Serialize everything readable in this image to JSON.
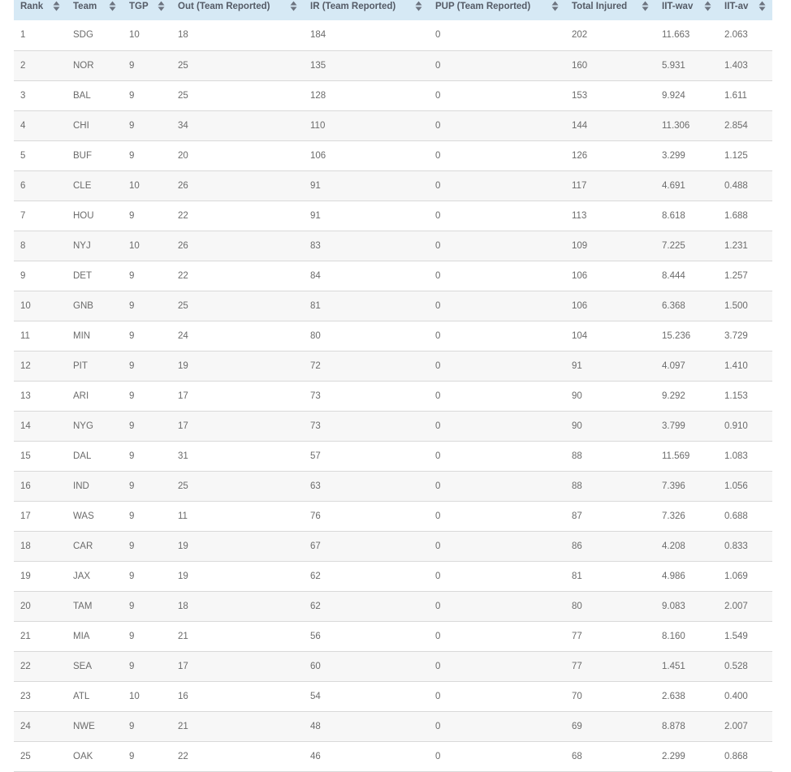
{
  "table": {
    "columns": [
      "Rank",
      "Team",
      "TGP",
      "Out (Team Reported)",
      "IR (Team Reported)",
      "PUP (Team Reported)",
      "Total Injured",
      "IIT-wav",
      "IIT-av"
    ],
    "rows": [
      [
        "1",
        "SDG",
        "10",
        "18",
        "184",
        "0",
        "202",
        "11.663",
        "2.063"
      ],
      [
        "2",
        "NOR",
        "9",
        "25",
        "135",
        "0",
        "160",
        "5.931",
        "1.403"
      ],
      [
        "3",
        "BAL",
        "9",
        "25",
        "128",
        "0",
        "153",
        "9.924",
        "1.611"
      ],
      [
        "4",
        "CHI",
        "9",
        "34",
        "110",
        "0",
        "144",
        "11.306",
        "2.854"
      ],
      [
        "5",
        "BUF",
        "9",
        "20",
        "106",
        "0",
        "126",
        "3.299",
        "1.125"
      ],
      [
        "6",
        "CLE",
        "10",
        "26",
        "91",
        "0",
        "117",
        "4.691",
        "0.488"
      ],
      [
        "7",
        "HOU",
        "9",
        "22",
        "91",
        "0",
        "113",
        "8.618",
        "1.688"
      ],
      [
        "8",
        "NYJ",
        "10",
        "26",
        "83",
        "0",
        "109",
        "7.225",
        "1.231"
      ],
      [
        "9",
        "DET",
        "9",
        "22",
        "84",
        "0",
        "106",
        "8.444",
        "1.257"
      ],
      [
        "10",
        "GNB",
        "9",
        "25",
        "81",
        "0",
        "106",
        "6.368",
        "1.500"
      ],
      [
        "11",
        "MIN",
        "9",
        "24",
        "80",
        "0",
        "104",
        "15.236",
        "3.729"
      ],
      [
        "12",
        "PIT",
        "9",
        "19",
        "72",
        "0",
        "91",
        "4.097",
        "1.410"
      ],
      [
        "13",
        "ARI",
        "9",
        "17",
        "73",
        "0",
        "90",
        "9.292",
        "1.153"
      ],
      [
        "14",
        "NYG",
        "9",
        "17",
        "73",
        "0",
        "90",
        "3.799",
        "0.910"
      ],
      [
        "15",
        "DAL",
        "9",
        "31",
        "57",
        "0",
        "88",
        "11.569",
        "1.083"
      ],
      [
        "16",
        "IND",
        "9",
        "25",
        "63",
        "0",
        "88",
        "7.396",
        "1.056"
      ],
      [
        "17",
        "WAS",
        "9",
        "11",
        "76",
        "0",
        "87",
        "7.326",
        "0.688"
      ],
      [
        "18",
        "CAR",
        "9",
        "19",
        "67",
        "0",
        "86",
        "4.208",
        "0.833"
      ],
      [
        "19",
        "JAX",
        "9",
        "19",
        "62",
        "0",
        "81",
        "4.986",
        "1.069"
      ],
      [
        "20",
        "TAM",
        "9",
        "18",
        "62",
        "0",
        "80",
        "9.083",
        "2.007"
      ],
      [
        "21",
        "MIA",
        "9",
        "21",
        "56",
        "0",
        "77",
        "8.160",
        "1.549"
      ],
      [
        "22",
        "SEA",
        "9",
        "17",
        "60",
        "0",
        "77",
        "1.451",
        "0.528"
      ],
      [
        "23",
        "ATL",
        "10",
        "16",
        "54",
        "0",
        "70",
        "2.638",
        "0.400"
      ],
      [
        "24",
        "NWE",
        "9",
        "21",
        "48",
        "0",
        "69",
        "8.878",
        "2.007"
      ],
      [
        "25",
        "OAK",
        "9",
        "22",
        "46",
        "0",
        "68",
        "2.299",
        "0.868"
      ]
    ]
  },
  "icons": {
    "sort": "sort-up-down-icon"
  },
  "colors": {
    "header_bg": "#d6e9f5",
    "header_text": "#555b66",
    "cell_text": "#6b6b6b",
    "row_alt_bg": "#f7f7f7",
    "row_border": "#d9d9d9"
  }
}
